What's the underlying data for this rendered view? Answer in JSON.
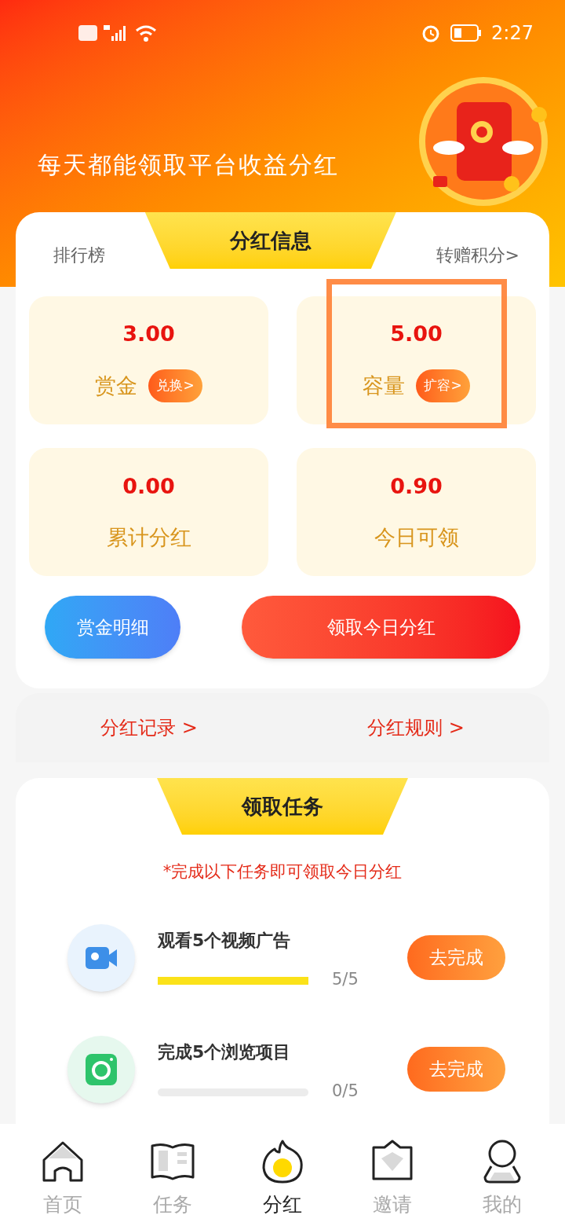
{
  "status_bar": {
    "time": "2:27"
  },
  "banner": {
    "title": "每天都能领取平台收益分红"
  },
  "dividend_card": {
    "left_link": "排行榜",
    "tab": "分红信息",
    "right_link": "转赠积分>",
    "stats": [
      {
        "value": "3.00",
        "label": "赏金",
        "action": "兑换>",
        "highlighted": false
      },
      {
        "value": "5.00",
        "label": "容量",
        "action": "扩容>",
        "highlighted": true
      },
      {
        "value": "0.00",
        "label": "累计分红",
        "highlighted": false
      },
      {
        "value": "0.90",
        "label": "今日可领",
        "highlighted": false
      }
    ],
    "buttons": [
      {
        "label": "赏金明细",
        "kind": "secondary"
      },
      {
        "label": "领取今日分红",
        "kind": "primary"
      }
    ]
  },
  "links": [
    "分红记录 >",
    "分红规则 >"
  ],
  "tasks_card": {
    "tab": "领取任务",
    "notice": "*完成以下任务即可领取今日分红",
    "tasks": [
      {
        "kind": "video",
        "title": "观看5个视频广告",
        "level": 1,
        "progress": "5/5",
        "button": "去完成"
      },
      {
        "kind": "camera",
        "title": "完成5个浏览项目",
        "level": 0,
        "progress": "0/5",
        "button": "去完成"
      }
    ]
  },
  "bottom_nav": [
    {
      "kind": "home",
      "label": "首页",
      "selected": false
    },
    {
      "kind": "book",
      "label": "任务",
      "selected": false
    },
    {
      "kind": "flame",
      "label": "分红",
      "selected": true
    },
    {
      "kind": "crown",
      "label": "邀请",
      "selected": false
    },
    {
      "kind": "person",
      "label": "我的",
      "selected": false
    }
  ]
}
